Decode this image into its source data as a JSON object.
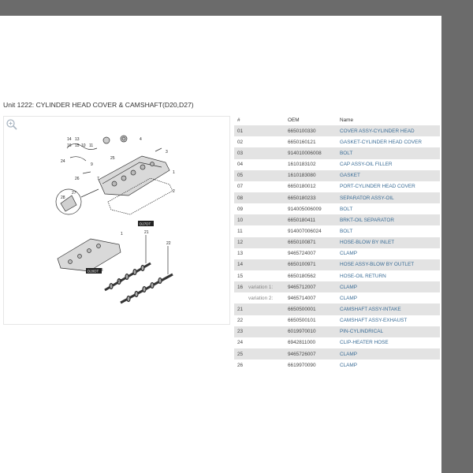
{
  "unit": {
    "title": "Unit 1222: CYLINDER HEAD COVER & CAMSHAFT(D20,D27)"
  },
  "diagram": {
    "zoom_icon": "magnifier-plus-icon",
    "engine_labels": [
      "D27DT",
      "D20DT"
    ],
    "callouts": [
      "14",
      "13",
      "16",
      "15",
      "10",
      "11",
      "3",
      "24",
      "26",
      "25",
      "9",
      "7",
      "4",
      "1",
      "2",
      "27",
      "28",
      "1",
      "21",
      "22",
      "23",
      "23"
    ]
  },
  "parts_table": {
    "headers": {
      "num": "#",
      "oem": "OEM",
      "name": "Name"
    },
    "rows": [
      {
        "num": "01",
        "variation": "",
        "oem": "6650100330",
        "name": "COVER ASSY-CYLINDER HEAD"
      },
      {
        "num": "02",
        "variation": "",
        "oem": "6650160121",
        "name": "GASKET-CYLINDER HEAD COVER"
      },
      {
        "num": "03",
        "variation": "",
        "oem": "914010006008",
        "name": "BOLT"
      },
      {
        "num": "04",
        "variation": "",
        "oem": "1610183102",
        "name": "CAP ASSY-OIL FILLER"
      },
      {
        "num": "05",
        "variation": "",
        "oem": "1610183080",
        "name": "GASKET"
      },
      {
        "num": "07",
        "variation": "",
        "oem": "6650180012",
        "name": "PORT-CYLINDER HEAD COVER"
      },
      {
        "num": "08",
        "variation": "",
        "oem": "6650180233",
        "name": "SEPARATOR ASSY-OIL"
      },
      {
        "num": "09",
        "variation": "",
        "oem": "914005006009",
        "name": "BOLT"
      },
      {
        "num": "10",
        "variation": "",
        "oem": "6650180411",
        "name": "BRKT-OIL SEPARATOR"
      },
      {
        "num": "11",
        "variation": "",
        "oem": "914007006024",
        "name": "BOLT"
      },
      {
        "num": "12",
        "variation": "",
        "oem": "6650100871",
        "name": "HOSE-BLOW BY INLET"
      },
      {
        "num": "13",
        "variation": "",
        "oem": "9465724007",
        "name": "CLAMP"
      },
      {
        "num": "14",
        "variation": "",
        "oem": "6650100971",
        "name": "HOSE ASSY-BLOW BY OUTLET"
      },
      {
        "num": "15",
        "variation": "",
        "oem": "6650180562",
        "name": "HOSE-OIL RETURN"
      },
      {
        "num": "16",
        "variation": "variation 1:",
        "oem": "9465712007",
        "name": "CLAMP"
      },
      {
        "num": "",
        "variation": "variation 2:",
        "oem": "9465714007",
        "name": "CLAMP"
      },
      {
        "num": "21",
        "variation": "",
        "oem": "6650500001",
        "name": "CAMSHAFT ASSY-INTAKE"
      },
      {
        "num": "22",
        "variation": "",
        "oem": "6650500101",
        "name": "CAMSHAFT ASSY-EXHAUST"
      },
      {
        "num": "23",
        "variation": "",
        "oem": "6019970010",
        "name": "PIN-CYLINDRICAL"
      },
      {
        "num": "24",
        "variation": "",
        "oem": "6942811000",
        "name": "CLIP-HEATER HOSE"
      },
      {
        "num": "25",
        "variation": "",
        "oem": "9465726007",
        "name": "CLAMP"
      },
      {
        "num": "26",
        "variation": "",
        "oem": "6619970090",
        "name": "CLAMP"
      }
    ]
  },
  "colors": {
    "link": "#3a6c96",
    "row_shade": "#e3e3e3",
    "frame": "#6b6b6b"
  }
}
